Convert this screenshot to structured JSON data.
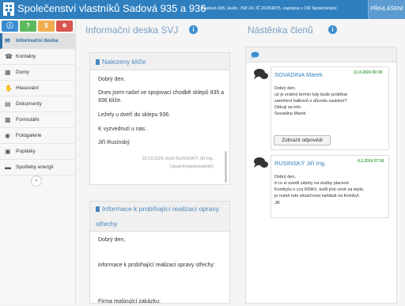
{
  "header": {
    "title": "Společenství vlastníků Sadová 935 a 936",
    "subtitle": "Sadová 935, Hulín, 768 24, IČ 26254875, zapsána v OR Společenství",
    "login": "PŘIHLÁŠENÍ"
  },
  "quick_buttons": [
    {
      "label": "",
      "color": "#3a8dd0"
    },
    {
      "label": "?",
      "color": "#5cb85c"
    },
    {
      "label": "$",
      "color": "#f0ad4e"
    },
    {
      "label": "",
      "color": "#d9534f"
    }
  ],
  "sidebar": {
    "items": [
      {
        "label": "Informační deska",
        "icon": "envelope-icon"
      },
      {
        "label": "Kontakty",
        "icon": "phone-icon"
      },
      {
        "label": "Domy",
        "icon": "folder-icon"
      },
      {
        "label": "Hlasování",
        "icon": "hand-icon"
      },
      {
        "label": "Dokumenty",
        "icon": "document-icon"
      },
      {
        "label": "Formuláře",
        "icon": "printer-icon"
      },
      {
        "label": "Fotogalerie",
        "icon": "camera-icon"
      },
      {
        "label": "Poplatky",
        "icon": "money-icon"
      },
      {
        "label": "Spotřeby energií",
        "icon": "chart-icon"
      }
    ],
    "collapse": "«"
  },
  "board": {
    "title": "Informační deska SVJ",
    "posts": [
      {
        "title": "Nalezeny klíče",
        "paragraphs": [
          "Dobrý den.",
          "Dnes jsem našel ve spojovací chodbě sklepů 935 a 936 klíče.",
          "Ležely u dveří do sklepu 936.",
          "K vyzvednutí u nás.",
          "Jiří Rusínský"
        ],
        "meta1": "15.03.2025 vložil RUSINSKÝ Jiří Ing.",
        "meta2": "(vlastník/spoluvlastník)"
      },
      {
        "title": "Informace k probíhající realizaci opravy střechy",
        "paragraphs": [
          "Dobrý den,",
          "informace k probíhající realizaci opravy střechy:",
          "Firma realizující zakázku:"
        ]
      }
    ]
  },
  "wall": {
    "title": "Nástěnka členů",
    "messages": [
      {
        "author": "SOVADINA Marek",
        "date": "11.4.2024 09:39",
        "lines": [
          "Dobrý den,",
          "už je známý termín kdy bude probíhat",
          "zamělení balkonů z důvodu zasklení?",
          "Děkuji za info.",
          "Sovadina Marek"
        ],
        "button": "Zobrazit odpovědi"
      },
      {
        "author": "RUSINSKÝ Jiří Ing.",
        "date": "4.1.2024 07:56",
        "lines": [
          "Dobrý den,",
          "ti co si zvedli zálohy na služby placené",
          "Kombytu o cca 600Kč, kvůli jiné ceně za teplo,",
          "je nutné tuto skutečnost nahlásit na Kombyt.",
          "JR"
        ]
      }
    ]
  }
}
